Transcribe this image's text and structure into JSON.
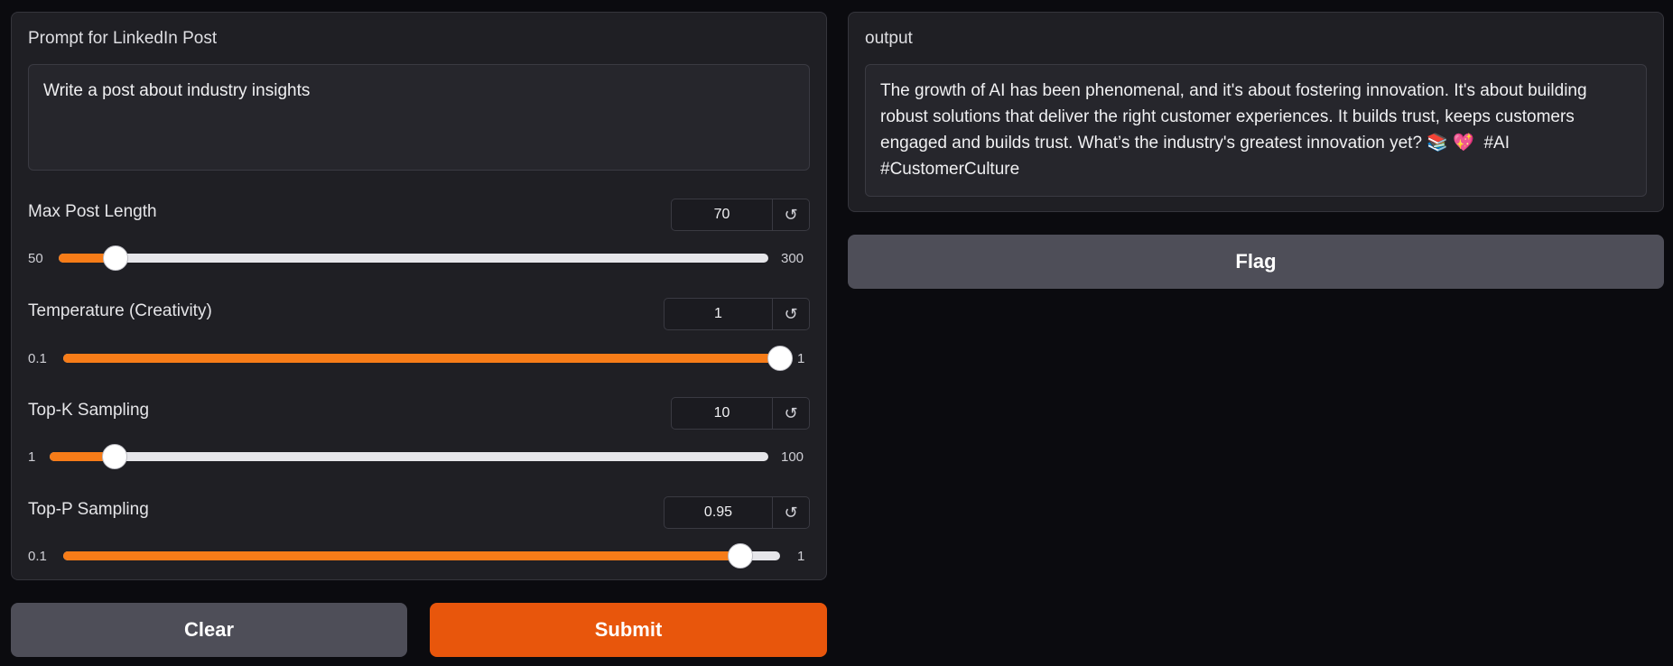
{
  "input_panel": {
    "prompt_label": "Prompt for LinkedIn Post",
    "prompt_value": "Write a post about industry insights"
  },
  "sliders": [
    {
      "label": "Max Post Length",
      "value": "70",
      "min": "50",
      "max": "300",
      "fraction": 0.08
    },
    {
      "label": "Temperature (Creativity)",
      "value": "1",
      "min": "0.1",
      "max": "1",
      "fraction": 1.0
    },
    {
      "label": "Top-K Sampling",
      "value": "10",
      "min": "1",
      "max": "100",
      "fraction": 0.091
    },
    {
      "label": "Top-P Sampling",
      "value": "0.95",
      "min": "0.1",
      "max": "1",
      "fraction": 0.944
    }
  ],
  "reset_icon": "↺",
  "output_panel": {
    "label": "output",
    "text": "The growth of AI has been phenomenal, and it's about fostering innovation. It's about building robust solutions that deliver the right customer experiences. It builds trust, keeps customers engaged and builds trust. What’s the industry's greatest innovation yet? 📚 💖  #AI #CustomerCulture"
  },
  "buttons": {
    "clear": "Clear",
    "submit": "Submit",
    "flag": "Flag"
  },
  "colors": {
    "accent": "#f77c18",
    "submit": "#e8560c",
    "secondary_button": "#4e4e58",
    "panel": "#1f1f24",
    "background": "#0b0b0f"
  }
}
